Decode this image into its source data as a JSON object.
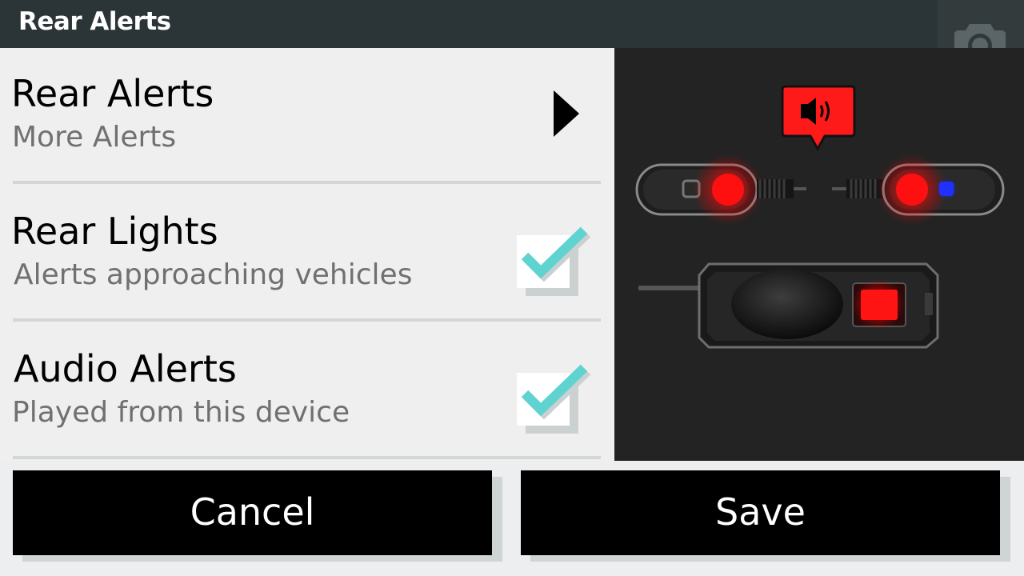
{
  "header": {
    "title": "Rear Alerts",
    "camera_icon": "camera-icon"
  },
  "rows": [
    {
      "label": "Rear Alerts",
      "sublabel": "More Alerts",
      "control": "chevron-right-icon"
    },
    {
      "label": "Rear Lights",
      "sublabel": "Alerts approaching vehicles",
      "checked": true
    },
    {
      "label": "Audio Alerts",
      "sublabel": "Played from this device",
      "checked": true
    }
  ],
  "preview": {
    "alert_icon": "speaker-alert-icon"
  },
  "buttons": {
    "cancel": "Cancel",
    "save": "Save"
  },
  "colors": {
    "accent": "#5fd3d0",
    "header": "#2b3436",
    "alert_red": "#ff1a1a",
    "preview_bg": "#232323"
  }
}
